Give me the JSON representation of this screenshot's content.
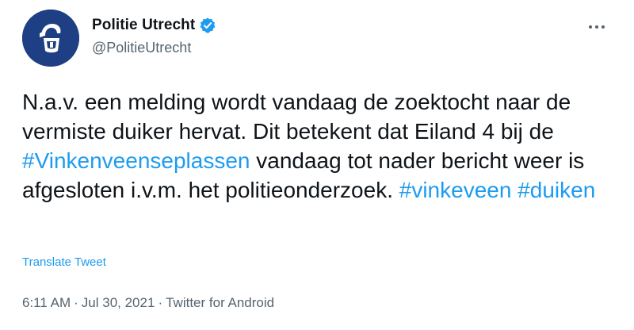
{
  "author": {
    "display_name": "Politie Utrecht",
    "handle": "@PolitieUtrecht",
    "verified": true,
    "avatar_icon": "police-logo-icon",
    "avatar_color": "#1f3f84"
  },
  "more_icon": "more-options-icon",
  "tweet": {
    "segments": [
      {
        "text": "N.a.v. een melding wordt vandaag de zoektocht naar de vermiste duiker hervat. Dit betekent dat Eiland 4 bij de ",
        "hashtag": false
      },
      {
        "text": "#Vinkenveenseplassen",
        "hashtag": true
      },
      {
        "text": " vandaag tot nader bericht weer is afgesloten i.v.m. het politieonderzoek. ",
        "hashtag": false
      },
      {
        "text": "#vinkeveen",
        "hashtag": true
      },
      {
        "text": " ",
        "hashtag": false
      },
      {
        "text": "#duiken",
        "hashtag": true
      }
    ]
  },
  "translate_label": "Translate Tweet",
  "meta": {
    "time": "6:11 AM",
    "separator": "·",
    "date": "Jul 30, 2021",
    "source": "Twitter for Android"
  },
  "colors": {
    "link": "#1d9bf0",
    "text": "#0f1419",
    "secondary": "#536471"
  }
}
